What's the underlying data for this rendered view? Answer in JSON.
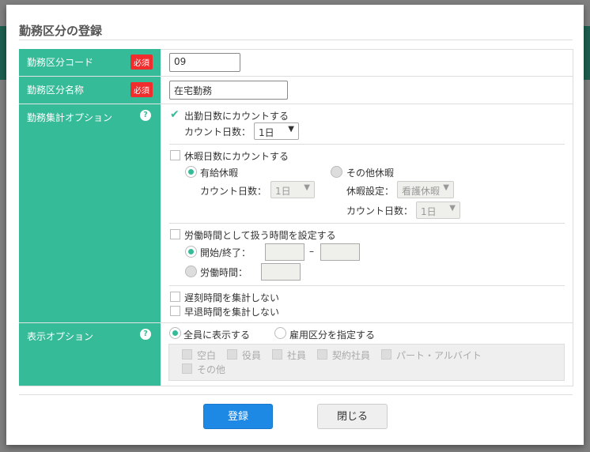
{
  "dialog": {
    "title": "勤務区分の登録"
  },
  "required_label": "必須",
  "help_icon": "?",
  "code": {
    "label": "勤務区分コード",
    "value": "09"
  },
  "name": {
    "label": "勤務区分名称",
    "value": "在宅勤務"
  },
  "agg": {
    "label": "勤務集計オプション",
    "attendance": {
      "label": "出勤日数にカウントする",
      "checked": true,
      "count_label": "カウント日数：",
      "count_value": "1日"
    },
    "leave": {
      "label": "休暇日数にカウントする",
      "checked": false,
      "paid": {
        "label": "有給休暇",
        "count_label": "カウント日数：",
        "count_value": "1日"
      },
      "other": {
        "label": "その他休暇",
        "setting_label": "休暇設定：",
        "setting_value": "看護休暇",
        "count_label": "カウント日数：",
        "count_value": "1日"
      }
    },
    "worktime": {
      "label": "労働時間として扱う時間を設定する",
      "checked": false,
      "startend_label": "開始/終了：",
      "dash": "–",
      "hours_label": "労働時間："
    },
    "late": {
      "label": "遅刻時間を集計しない",
      "checked": false
    },
    "early": {
      "label": "早退時間を集計しない",
      "checked": false
    }
  },
  "display": {
    "label": "表示オプション",
    "all": "全員に表示する",
    "specify": "雇用区分を指定する",
    "types": [
      "空白",
      "役員",
      "社員",
      "契約社員",
      "パート・アルバイト",
      "その他"
    ]
  },
  "buttons": {
    "register": "登録",
    "close": "閉じる"
  },
  "colors": {
    "accent": "#36bb98",
    "required": "#f22d2d",
    "primary": "#1e88e5"
  }
}
